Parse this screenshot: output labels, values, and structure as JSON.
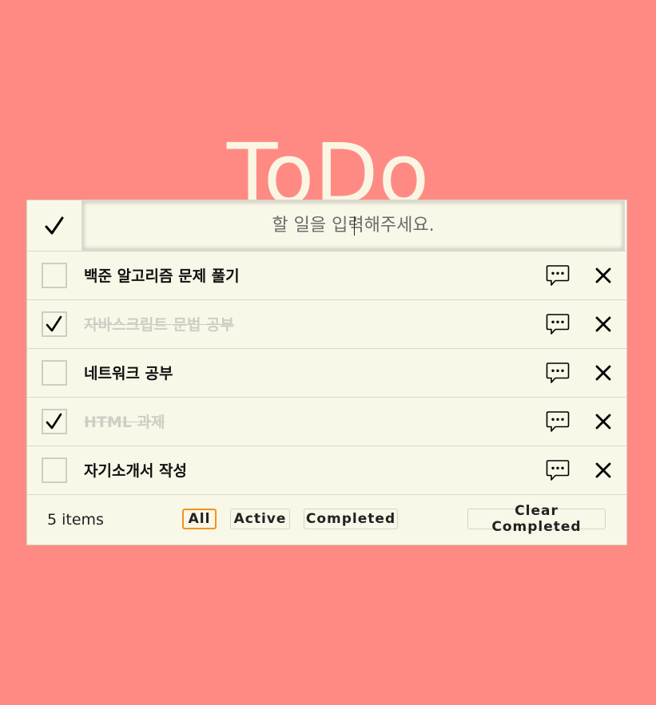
{
  "title": "ToDo",
  "new_todo": {
    "placeholder": "할 일을 입력해주세요."
  },
  "todos": [
    {
      "text": "백준 알고리즘 문제 풀기",
      "completed": false
    },
    {
      "text": "자바스크립트 문법 공부",
      "completed": true
    },
    {
      "text": "네트워크 공부",
      "completed": false
    },
    {
      "text": "HTML 과제",
      "completed": true
    },
    {
      "text": "자기소개서 작성",
      "completed": false
    }
  ],
  "footer": {
    "count_label": "5 items",
    "filters": [
      "All",
      "Active",
      "Completed"
    ],
    "selected_filter": "All",
    "clear_label": "Clear Completed"
  },
  "colors": {
    "background": "#ff8a84",
    "panel": "#f9f7e7",
    "title": "#fbf6e3",
    "selected_filter_border": "#f0941c",
    "completed_text": "#cfcdc4"
  },
  "icons": {
    "toggle_all": "check-icon",
    "item_comment": "speech-bubble-icon",
    "item_delete": "close-icon"
  }
}
